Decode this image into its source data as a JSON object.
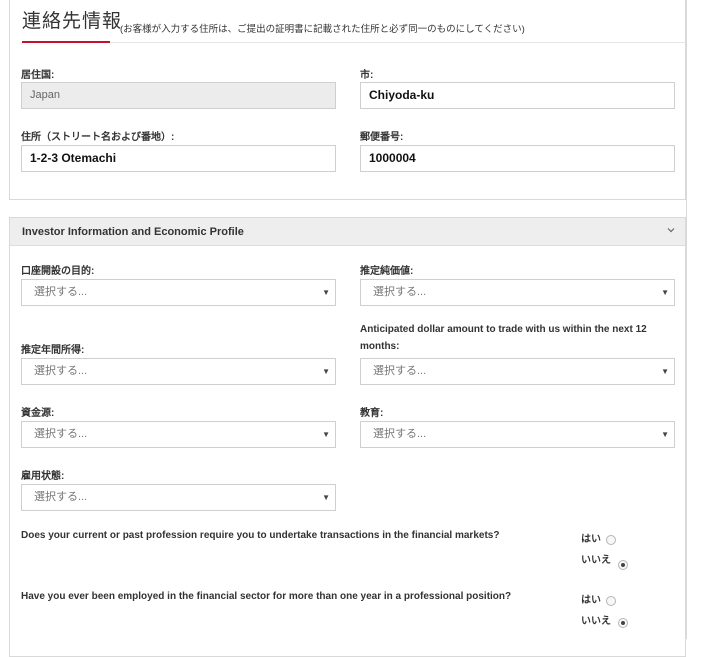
{
  "contact": {
    "title": "連絡先情報",
    "note": "(お客様が入力する住所は、ご提出の証明書に記載された住所と必ず同一のものにしてください)",
    "country_label": "居住国:",
    "country_value": "Japan",
    "city_label": "市:",
    "city_value": "Chiyoda-ku",
    "address_label": "住所（ストリート名および番地）:",
    "address_value": "1-2-3 Otemachi",
    "postal_label": "郵便番号:",
    "postal_value": "1000004"
  },
  "investor": {
    "title": "Investor Information and Economic Profile",
    "placeholder": "選択する...",
    "fields": {
      "purpose_label": "口座開設の目的:",
      "networth_label": "推定純価値:",
      "income_label": "推定年間所得:",
      "dollar_label_line1": "Anticipated dollar amount to trade with us within the next 12",
      "dollar_label_line2": "months:",
      "funds_label": "資金源:",
      "education_label": "教育:",
      "employment_label": "雇用状態:"
    },
    "questions": [
      {
        "text": "Does your current or past profession require you to undertake transactions in the financial markets?",
        "yes": "はい",
        "no": "いいえ",
        "selected": "no"
      },
      {
        "text": "Have you ever been employed in the financial sector for more than one year in a professional position?",
        "yes": "はい",
        "no": "いいえ",
        "selected": "no"
      }
    ]
  },
  "icons": {
    "collapse": "chevron-down-icon",
    "select_caret": "triangle-down-icon"
  },
  "colors": {
    "accent": "#c8102e",
    "header_bg": "#eeeeee",
    "disabled_bg": "#ececec"
  }
}
